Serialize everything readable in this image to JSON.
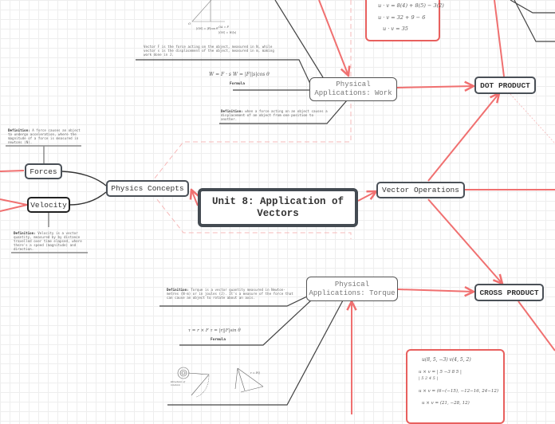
{
  "colors": {
    "accent_link": "#f07070",
    "dashed_boundary": "#f6b8b8",
    "node_border": "#4a5057",
    "dark_link": "#444444",
    "grid": "#eeeeee"
  },
  "root": {
    "title": "Unit 8: Application of Vectors"
  },
  "branches": {
    "physics_concepts": {
      "label": "Physics Concepts"
    },
    "forces": {
      "label": "Forces"
    },
    "velocity": {
      "label": "Velocity"
    },
    "vector_operations": {
      "label": "Vector Operations"
    },
    "dot_product": {
      "label": "DOT PRODUCT"
    },
    "cross_product": {
      "label": "CROSS PRODUCT"
    },
    "work": {
      "label_line1": "Physical",
      "label_line2": "Applications: Work"
    },
    "torque": {
      "label_line1": "Physical",
      "label_line2": "Applications: Torque"
    }
  },
  "notes": {
    "forces_def_term": "Definition:",
    "forces_def_text": "A force causes an object to undergo acceleration, where the magnitude of a force is measured in newtons (N).",
    "velocity_def_term": "Definition:",
    "velocity_def_text": "Velocity is a vector quantity, measured by by distance travelled over time elapsed, where there's a speed (magnitude) and direction.",
    "work_vector_text": "Vector F is the force acting on the object, measured in N, while vector s is the displacement of the object, measured in m, making work done in J.",
    "work_formula": "W = F · s    W = |F||s|cos θ",
    "work_formula_caption": "Formula",
    "work_def_term": "Definition:",
    "work_def_text": "when a force acting on an object causes a displacement of an object from one position to another.",
    "torque_def_term": "Definition:",
    "torque_def_text": "Torque is a vector quantity measured in Newton-metres (N·m) or in joules (J). It's a measure of the force that can cause an object to rotate about an axis.",
    "torque_formula": "τ = r × F    τ = |r||F|sin θ",
    "torque_formula_caption": "Formula",
    "work_diagram_labels": [
      "O",
      "N",
      "P",
      "|ON| = |F|cos θ",
      "OA = F",
      "|ON| = W/|s|"
    ],
    "torque_diagram_labels": [
      "Direction of rotation",
      "Axis",
      "r = PQ",
      "F",
      "θ"
    ]
  },
  "dot_product_example": [
    "u · v = 8(4) + 8(5) − 3(2)",
    "u · v = 32 + 9 − 6",
    "u · v = 35"
  ],
  "cross_product_example": [
    "u(8, 5, −3)  v(4, 5, 2)",
    "u × v = | 5 −3 8 5 |",
    "         | 5  2 4 5 |",
    "u × v = (6−(−15), −12−16, 24−12)",
    "u × v = (21, −28, 12)"
  ]
}
